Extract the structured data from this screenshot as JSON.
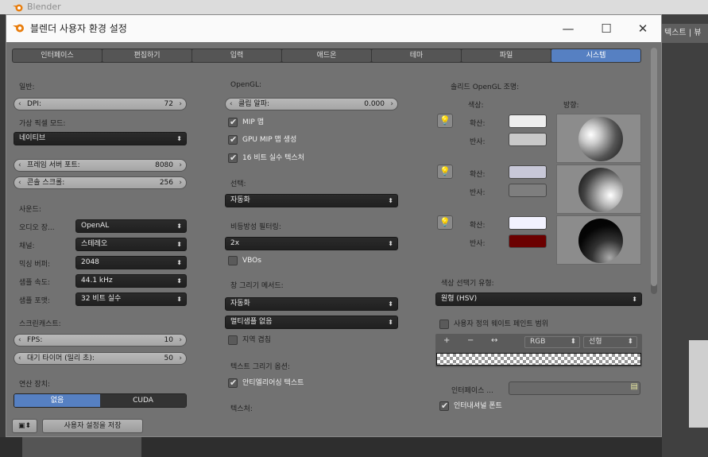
{
  "bg_window": {
    "title": "Blender"
  },
  "viewport": {
    "header_text": "텍스트 | 뷰"
  },
  "window": {
    "title": "블렌더 사용자 환경 설정",
    "minimize": "—",
    "maximize": "☐",
    "close": "✕"
  },
  "tabs": [
    "인터페이스",
    "편집하기",
    "입력",
    "애드온",
    "테마",
    "파일",
    "시스템"
  ],
  "active_tab": "시스템",
  "col1": {
    "general_label": "일반:",
    "dpi_label": "DPI:",
    "dpi_value": "72",
    "virtual_pixel_label": "가상 픽셀 모드:",
    "virtual_pixel_value": "네이티브",
    "frame_server_label": "프레임 서버 포트:",
    "frame_server_value": "8080",
    "console_scroll_label": "콘솔 스크롤:",
    "console_scroll_value": "256",
    "sound_label": "사운드:",
    "audio_device_label": "오디오 장...",
    "audio_device_value": "OpenAL",
    "channels_label": "채널:",
    "channels_value": "스테레오",
    "mix_buffer_label": "믹싱 버퍼:",
    "mix_buffer_value": "2048",
    "sample_rate_label": "샘플 속도:",
    "sample_rate_value": "44.1 kHz",
    "sample_format_label": "샘플 포맷:",
    "sample_format_value": "32 비트 실수",
    "screencast_label": "스크린캐스트:",
    "fps_label": "FPS:",
    "fps_value": "10",
    "wait_timer_label": "대기 타이머 (밀리 초):",
    "wait_timer_value": "50",
    "compute_device_label": "연산 장치:",
    "compute_none": "없음",
    "compute_cuda": "CUDA",
    "save_settings": "사용자 설정을 저장"
  },
  "col2": {
    "opengl_label": "OpenGL:",
    "clip_alpha_label": "클립 알파:",
    "clip_alpha_value": "0.000",
    "mipmap_label": "MIP 맵",
    "gpu_mipmap_label": "GPU MIP 맵 생성",
    "float_tex_label": "16 비트 실수 텍스처",
    "selection_label": "선택:",
    "selection_value": "자동화",
    "aniso_label": "비등방성 필터링:",
    "aniso_value": "2x",
    "vbos_label": "VBOs",
    "window_draw_label": "창 그리기 메서드:",
    "window_draw_value": "자동화",
    "multisample_value": "멀티샘플 없음",
    "region_overlap_label": "지역 겹침",
    "text_draw_label": "텍스트 그리기 옵션:",
    "antialias_text_label": "안티엘리어싱 텍스트",
    "textures_label": "텍스처:"
  },
  "col3": {
    "solid_opengl_label": "솔리드 OpenGL 조명:",
    "colors_header": "색상:",
    "direction_header": "방향:",
    "diffuse_label": "확산:",
    "specular_label": "반사:",
    "lights": [
      {
        "diffuse_color": "#eeeeee",
        "specular_color": "#c9c9c9"
      },
      {
        "diffuse_color": "#c8c8d8",
        "specular_color": "#7e7e7e"
      },
      {
        "diffuse_color": "#f2f2ff",
        "specular_color": "#6b0000"
      }
    ],
    "color_picker_label": "색상 선택기 유형:",
    "color_picker_value": "원형 (HSV)",
    "custom_weight_label": "사용자 정의 웨이트 페인트 범위",
    "ramp_add": "+",
    "ramp_remove": "−",
    "ramp_flip": "↔",
    "ramp_mode": "RGB",
    "ramp_interp": "선형",
    "interface_label": "인터페이스 ...",
    "international_fonts_label": "인터내셔널 폰트"
  },
  "colors": {
    "accent": "#5680c2",
    "panel": "#727272"
  }
}
